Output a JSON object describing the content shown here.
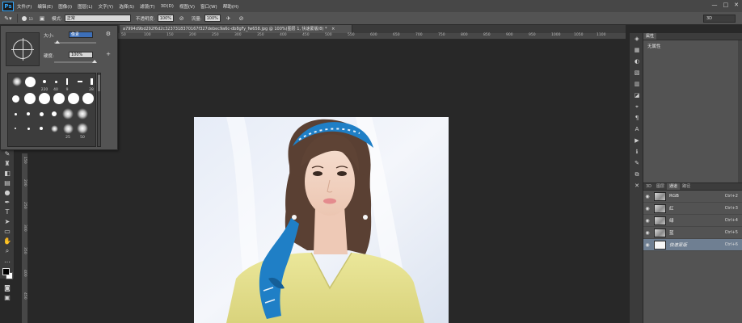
{
  "app": {
    "logo": "Ps"
  },
  "menu": [
    "文件(F)",
    "编辑(E)",
    "图像(I)",
    "图层(L)",
    "文字(Y)",
    "选择(S)",
    "滤镜(T)",
    "3D(D)",
    "视图(V)",
    "窗口(W)",
    "帮助(H)"
  ],
  "window_controls": {
    "minimize": "—",
    "maximize": "□",
    "close": "✕"
  },
  "options": {
    "brush_size": "13",
    "mode_label": "模式:",
    "mode_value": "正常",
    "opacity_label": "不透明度:",
    "opacity_value": "100%",
    "flow_label": "流量:",
    "flow_value": "100%",
    "workspace": "3D"
  },
  "document": {
    "tab_title": "a7994d9bd292f6d2c3237318370167f327debec9a6c-db8gFy_fw658.jpg @ 100%(图层 1, 快速蒙版/8) *",
    "close": "×"
  },
  "ruler": {
    "labels": [
      "50",
      "100",
      "150",
      "200",
      "250",
      "300",
      "350",
      "400",
      "450",
      "500",
      "550",
      "600",
      "650",
      "700",
      "750",
      "800",
      "850",
      "900",
      "950",
      "1000",
      "1050",
      "1100"
    ],
    "v_labels": [
      "150",
      "200",
      "250",
      "300",
      "350",
      "400",
      "450"
    ]
  },
  "brush_panel": {
    "size_label": "大小:",
    "size_value": "像素",
    "hardness_label": "硬度:",
    "hardness_value": "100%",
    "gear": "⚙",
    "add": "+",
    "preset_numbers": [
      "220",
      "40",
      "9",
      "28",
      "25",
      "50"
    ]
  },
  "properties": {
    "tab": "属性",
    "content": "无属性"
  },
  "channels_panel": {
    "tabs": [
      "3D",
      "图层",
      "通道",
      "路径"
    ],
    "active_tab_index": 2,
    "rows": [
      {
        "name": "RGB",
        "shortcut": "Ctrl+2"
      },
      {
        "name": "红",
        "shortcut": "Ctrl+3"
      },
      {
        "name": "绿",
        "shortcut": "Ctrl+4"
      },
      {
        "name": "蓝",
        "shortcut": "Ctrl+5"
      },
      {
        "name": "快速蒙版",
        "shortcut": "Ctrl+6"
      }
    ]
  },
  "colors": {
    "accent": "#31a8ff",
    "panel": "#535353",
    "active_row": "#6f7f92",
    "scarf": "#1f7fc6",
    "sweater": "#e4e08f"
  }
}
